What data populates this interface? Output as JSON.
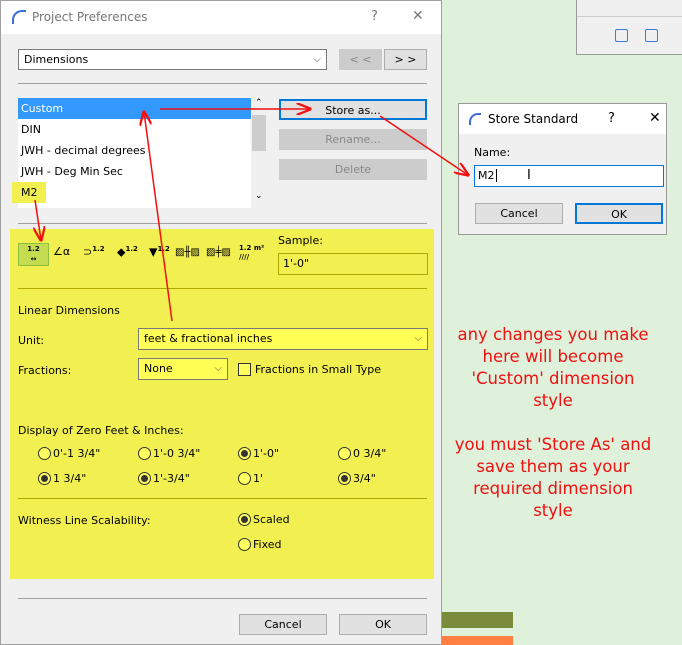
{
  "main_dialog": {
    "title": "Project Preferences",
    "help": "?",
    "close": "✕",
    "page_select": "Dimensions",
    "prev": "< <",
    "next": "> >",
    "standards": [
      "Custom",
      "DIN",
      "JWH - decimal degrees",
      "JWH - Deg Min Sec",
      "M2"
    ],
    "store_as": "Store as...",
    "rename": "Rename...",
    "delete": "Delete",
    "dim_type_icons": [
      "linear-dim",
      "angle-dim",
      "radius-dim",
      "level-dim",
      "elevation-dim",
      "door-window-dim",
      "sill-height-dim",
      "area-dim"
    ],
    "dim_labels": [
      "1.2",
      "α",
      "1.2",
      "1.2",
      "1.2",
      "",
      "",
      "1.2 m²"
    ],
    "sample_label": "Sample:",
    "sample_value": "1'-0\"",
    "section_linear": "Linear Dimensions",
    "unit_label": "Unit:",
    "unit_value": "feet & fractional inches",
    "fractions_label": "Fractions:",
    "fractions_value": "None",
    "fractions_small": "Fractions in Small Type",
    "zero_label": "Display of Zero Feet & Inches:",
    "zero_options": [
      {
        "label": "0'-1 3/4\"",
        "checked": false
      },
      {
        "label": "1'-0 3/4\"",
        "checked": false
      },
      {
        "label": "1'-0\"",
        "checked": true
      },
      {
        "label": "0 3/4\"",
        "checked": false
      },
      {
        "label": "1 3/4\"",
        "checked": true
      },
      {
        "label": "1'-3/4\"",
        "checked": true
      },
      {
        "label": "1'",
        "checked": false
      },
      {
        "label": "3/4\"",
        "checked": true
      }
    ],
    "witness_label": "Witness Line Scalability:",
    "witness_options": [
      {
        "label": "Scaled",
        "checked": true
      },
      {
        "label": "Fixed",
        "checked": false
      }
    ],
    "cancel": "Cancel",
    "ok": "OK"
  },
  "store_dialog": {
    "title": "Store Standard",
    "help": "?",
    "close": "✕",
    "name_label": "Name:",
    "name_value": "M2",
    "cancel": "Cancel",
    "ok": "OK"
  },
  "annotation": {
    "line1": [
      "any changes you make",
      "here will become",
      "'Custom' dimension",
      "style"
    ],
    "line2": [
      "you must 'Store As' and",
      "save them as your",
      "required dimension",
      "style"
    ]
  },
  "colors": {
    "highlight": "#f2f050",
    "arrow": "#f01010",
    "selection": "#3399ff"
  }
}
